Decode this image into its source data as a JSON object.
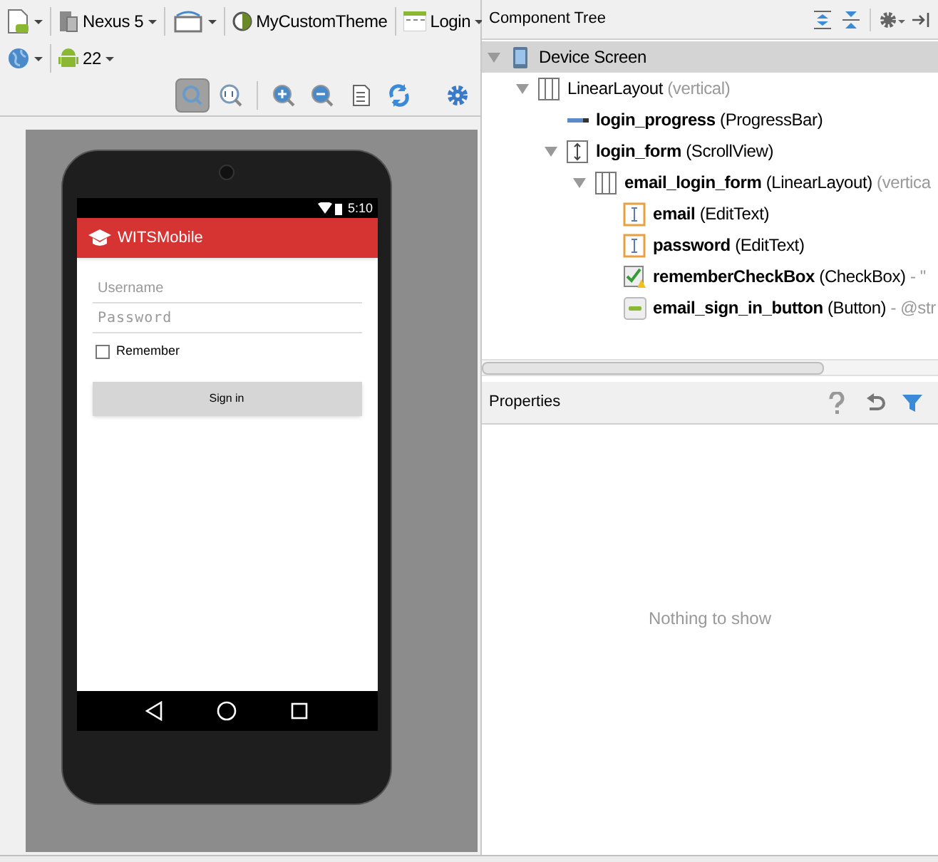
{
  "toolbar": {
    "device": "Nexus 5",
    "theme": "MyCustomTheme",
    "activity": "Login",
    "api": "22",
    "zoom_tools": [
      {
        "kind": "fit",
        "selected": true
      },
      {
        "kind": "actual",
        "selected": false
      },
      {
        "kind": "zoom-in",
        "selected": false
      },
      {
        "kind": "zoom-out",
        "selected": false
      },
      {
        "kind": "page",
        "selected": false
      },
      {
        "kind": "refresh",
        "selected": false
      }
    ]
  },
  "phone": {
    "time": "5:10",
    "app_title": "WITSMobile",
    "username_placeholder": "Username",
    "password_placeholder": "Password",
    "remember": {
      "label": "Remember",
      "checked": false
    },
    "sign_in": "Sign in"
  },
  "component_tree": {
    "title": "Component Tree",
    "items": [
      {
        "label": "Device Screen",
        "kind": "device",
        "expanded": true,
        "selected": true,
        "children": [
          {
            "label": "LinearLayout",
            "extra": "(vertical)",
            "kind": "linear",
            "expanded": true,
            "selected": false,
            "children": [
              {
                "label": "login_progress",
                "type": "(ProgressBar)",
                "kind": "progress",
                "selected": false
              },
              {
                "label": "login_form",
                "type": "(ScrollView)",
                "kind": "scroll",
                "expanded": true,
                "selected": false,
                "children": [
                  {
                    "label": "email_login_form",
                    "type": "(LinearLayout)",
                    "extra": "(vertica",
                    "kind": "linear",
                    "expanded": true,
                    "selected": false,
                    "children": [
                      {
                        "label": "email",
                        "type": "(EditText)",
                        "kind": "edittext",
                        "selected": false
                      },
                      {
                        "label": "password",
                        "type": "(EditText)",
                        "kind": "edittext",
                        "selected": false
                      },
                      {
                        "label": "rememberCheckBox",
                        "type": "(CheckBox)",
                        "extra": "- \"",
                        "kind": "checkbox",
                        "selected": false
                      },
                      {
                        "label": "email_sign_in_button",
                        "type": "(Button)",
                        "extra": "- @str",
                        "kind": "button",
                        "selected": false
                      }
                    ]
                  }
                ]
              }
            ]
          }
        ]
      }
    ]
  },
  "properties": {
    "title": "Properties",
    "empty_text": "Nothing to show"
  }
}
